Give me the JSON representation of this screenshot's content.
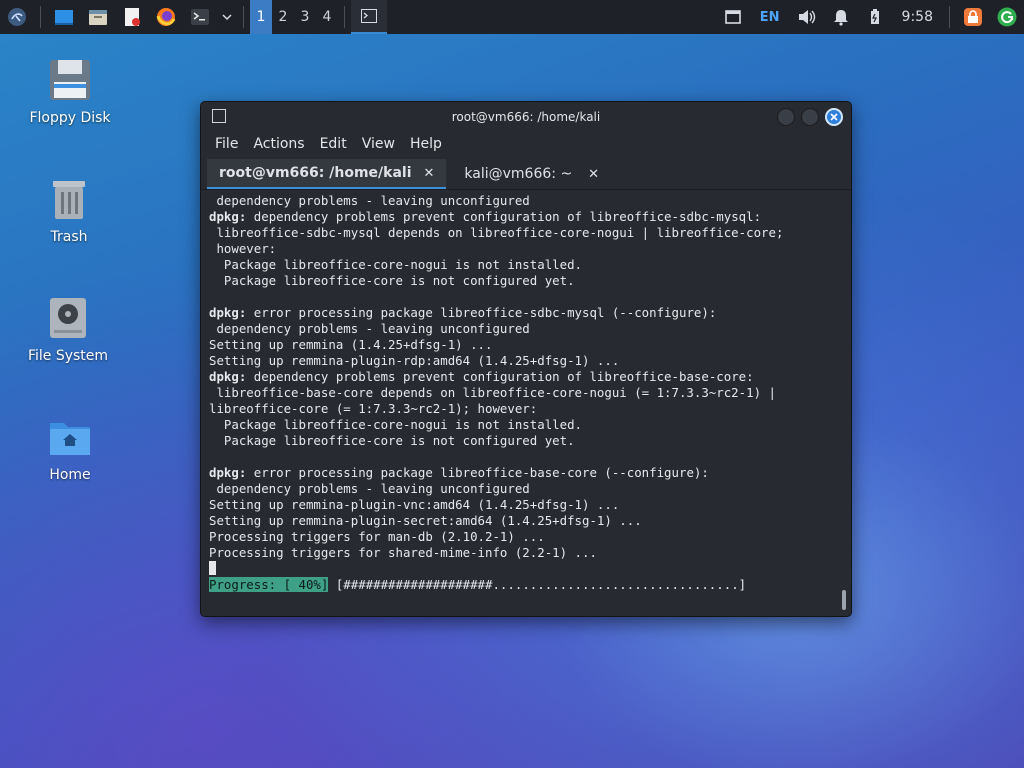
{
  "panel": {
    "workspaces": [
      "1",
      "2",
      "3",
      "4"
    ],
    "language": "EN",
    "clock": "9:58",
    "icons": [
      "kali-menu-icon",
      "show-desktop-icon",
      "file-manager-icon",
      "text-editor-icon",
      "firefox-icon",
      "terminal-icon",
      "chevron-down-icon"
    ]
  },
  "desktop": {
    "icons": [
      {
        "label": "Floppy Disk",
        "icon": "floppy-icon"
      },
      {
        "label": "Trash",
        "icon": "trash-icon"
      },
      {
        "label": "File System",
        "icon": "drive-icon"
      },
      {
        "label": "Home",
        "icon": "home-folder-icon"
      }
    ]
  },
  "window": {
    "title": "root@vm666: /home/kali",
    "menu": [
      "File",
      "Actions",
      "Edit",
      "View",
      "Help"
    ],
    "tabs": [
      {
        "label": "root@vm666: /home/kali",
        "active": true
      },
      {
        "label": "kali@vm666: ~",
        "active": false
      }
    ]
  },
  "terminal": {
    "lines": [
      {
        "t": " dependency problems - leaving unconfigured"
      },
      {
        "b": "dpkg:",
        "t": " dependency problems prevent configuration of libreoffice-sdbc-mysql:"
      },
      {
        "t": " libreoffice-sdbc-mysql depends on libreoffice-core-nogui | libreoffice-core;"
      },
      {
        "t": " however:"
      },
      {
        "t": "  Package libreoffice-core-nogui is not installed."
      },
      {
        "t": "  Package libreoffice-core is not configured yet."
      },
      {
        "t": ""
      },
      {
        "b": "dpkg:",
        "t": " error processing package libreoffice-sdbc-mysql (--configure):"
      },
      {
        "t": " dependency problems - leaving unconfigured"
      },
      {
        "t": "Setting up remmina (1.4.25+dfsg-1) ..."
      },
      {
        "t": "Setting up remmina-plugin-rdp:amd64 (1.4.25+dfsg-1) ..."
      },
      {
        "b": "dpkg:",
        "t": " dependency problems prevent configuration of libreoffice-base-core:"
      },
      {
        "t": " libreoffice-base-core depends on libreoffice-core-nogui (= 1:7.3.3~rc2-1) |"
      },
      {
        "t": "libreoffice-core (= 1:7.3.3~rc2-1); however:"
      },
      {
        "t": "  Package libreoffice-core-nogui is not installed."
      },
      {
        "t": "  Package libreoffice-core is not configured yet."
      },
      {
        "t": ""
      },
      {
        "b": "dpkg:",
        "t": " error processing package libreoffice-base-core (--configure):"
      },
      {
        "t": " dependency problems - leaving unconfigured"
      },
      {
        "t": "Setting up remmina-plugin-vnc:amd64 (1.4.25+dfsg-1) ..."
      },
      {
        "t": "Setting up remmina-plugin-secret:amd64 (1.4.25+dfsg-1) ..."
      },
      {
        "t": "Processing triggers for man-db (2.10.2-1) ..."
      },
      {
        "t": "Processing triggers for shared-mime-info (2.2-1) ..."
      }
    ],
    "progress_label": "Progress: [ 40%]",
    "progress_bar": " [####################.................................]",
    "progress_percent": 40
  },
  "colors": {
    "accent": "#3b8fd9",
    "progress": "#3fa088"
  }
}
